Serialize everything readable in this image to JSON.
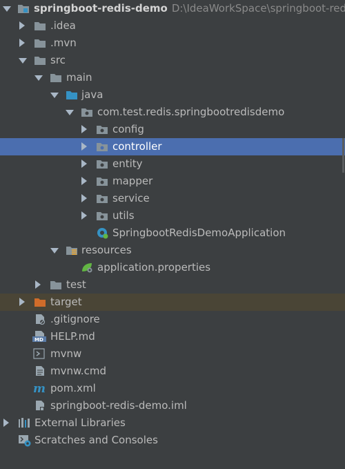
{
  "project_tree": {
    "root": {
      "name": "springboot-redis-demo",
      "path": "D:\\IdeaWorkSpace\\springboot-redis"
    },
    "idea": ".idea",
    "mvn": ".mvn",
    "src": "src",
    "main": "main",
    "java": "java",
    "package": "com.test.redis.springbootredisdemo",
    "config": "config",
    "controller": "controller",
    "entity": "entity",
    "mapper": "mapper",
    "service": "service",
    "utils": "utils",
    "app_class": "SpringbootRedisDemoApplication",
    "resources": "resources",
    "app_props": "application.properties",
    "test": "test",
    "target": "target",
    "gitignore": ".gitignore",
    "help": "HELP.md",
    "mvnw": "mvnw",
    "mvnw_cmd": "mvnw.cmd",
    "pom": "pom.xml",
    "iml": "springboot-redis-demo.iml",
    "ext_libs": "External Libraries",
    "scratches": "Scratches and Consoles"
  },
  "colors": {
    "background": "#3c3f41",
    "selection": "#4b6eaf",
    "excluded_row": "#4a4536",
    "folder": "#87939a",
    "source_folder": "#3592c4",
    "target_folder": "#d06c2a"
  },
  "selected_item": "controller"
}
